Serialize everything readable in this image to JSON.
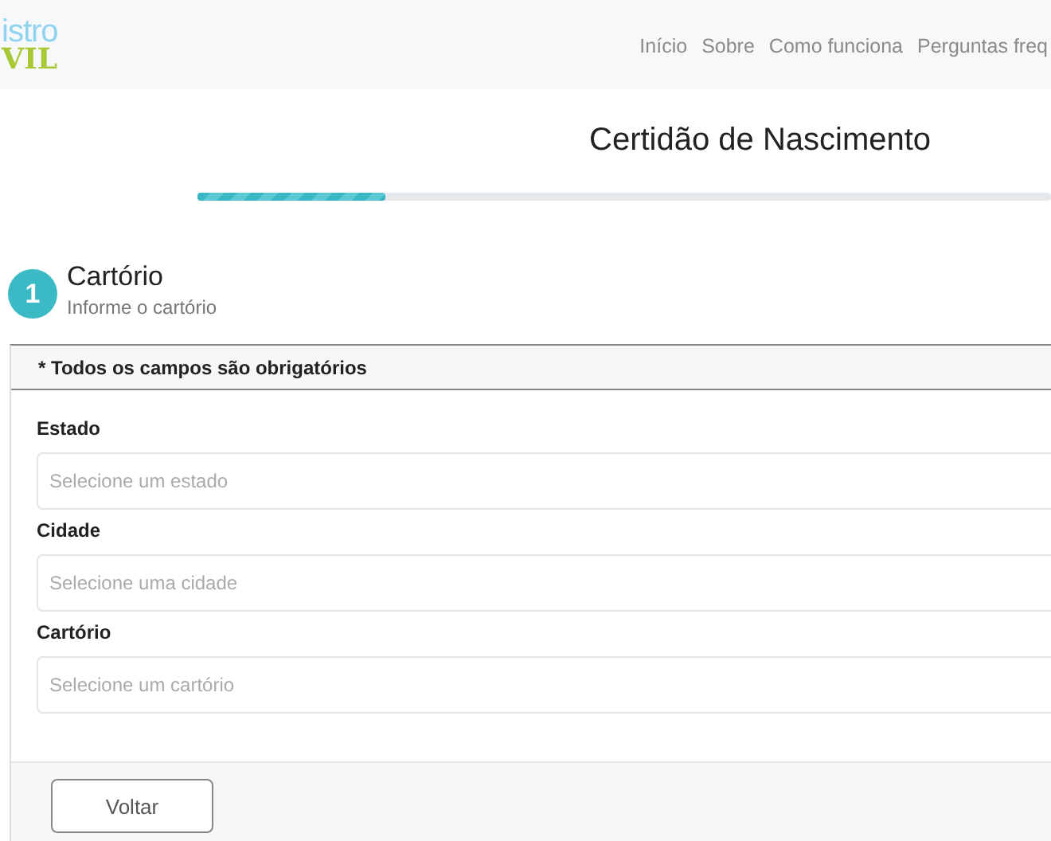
{
  "header": {
    "logo": {
      "top": "istro",
      "bottom": "VIL"
    },
    "nav": [
      "Início",
      "Sobre",
      "Como funciona",
      "Perguntas freq"
    ]
  },
  "page_title": "Certidão de Nascimento",
  "progress": {
    "level": 0.22
  },
  "step": {
    "number": "1",
    "title": "Cartório",
    "subtitle": "Informe o cartório"
  },
  "form": {
    "notice": "* Todos os campos são obrigatórios",
    "fields": [
      {
        "label": "Estado",
        "placeholder": "Selecione um estado"
      },
      {
        "label": "Cidade",
        "placeholder": "Selecione uma cidade"
      },
      {
        "label": "Cartório",
        "placeholder": "Selecione um cartório"
      }
    ],
    "buttons": [
      "Voltar"
    ]
  }
}
